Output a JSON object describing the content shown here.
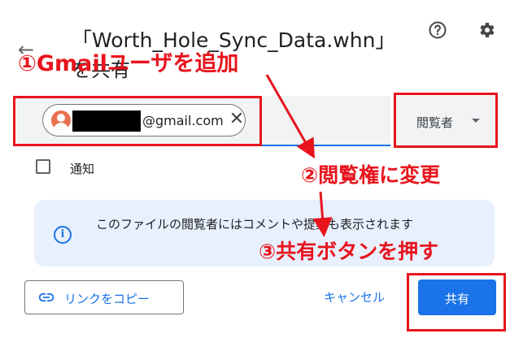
{
  "dialog": {
    "title": "「Worth_Hole_Sync_Data.whn」",
    "subtitle": "を共有",
    "help_icon": "help-circle-icon",
    "settings_icon": "gear-icon"
  },
  "recipient_chip": {
    "email_suffix": "@gmail.com",
    "close_symbol": "✕"
  },
  "role_select": {
    "selected": "閲覧者"
  },
  "notify": {
    "label": "通知",
    "checked": false
  },
  "info": {
    "icon_symbol": "i",
    "text": "このファイルの閲覧者にはコメントや提案も表示されます"
  },
  "footer": {
    "copy_link_label": "リンクをコピー",
    "cancel_label": "キャンセル",
    "share_label": "共有"
  },
  "annotations": {
    "step1": "①Gmailユーザを追加",
    "step2": "②閲覧権に変更",
    "step3": "③共有ボタンを押す"
  },
  "colors": {
    "accent": "#1a73e8",
    "annotation": "#e8141d",
    "info_bg": "#e8f0fe",
    "input_bg": "#f1f3f4"
  }
}
